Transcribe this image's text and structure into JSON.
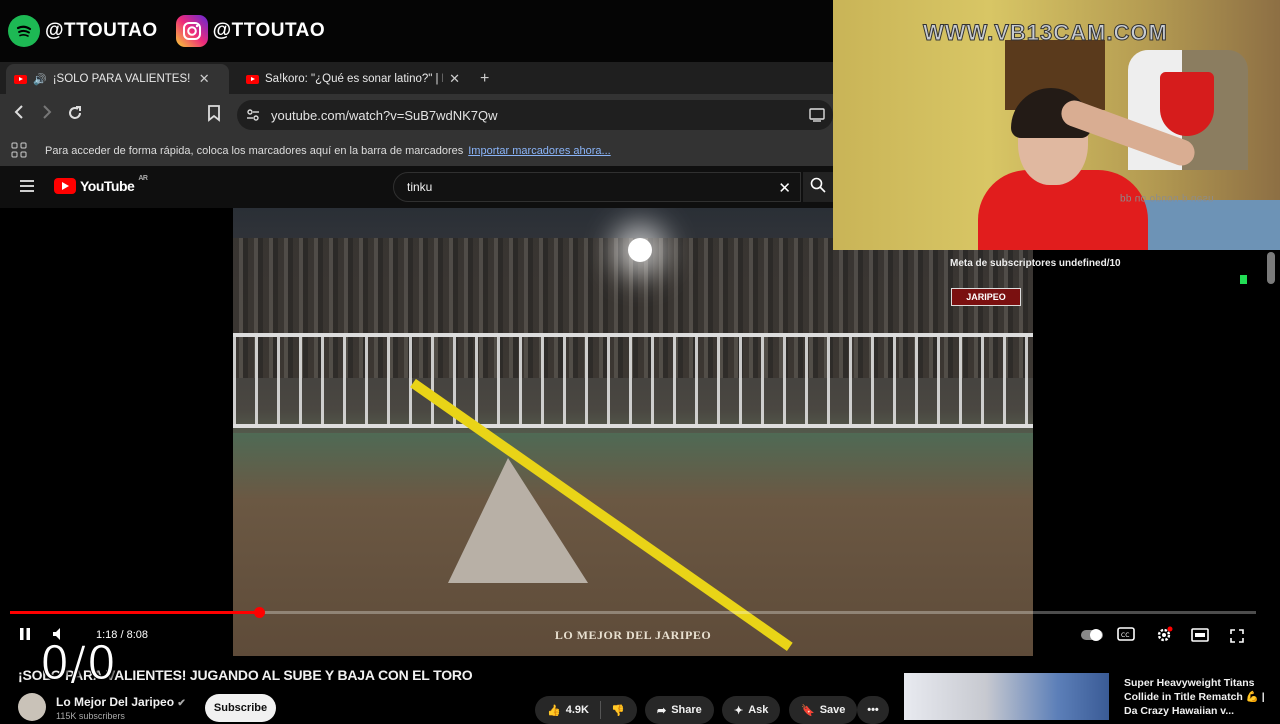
{
  "social": {
    "spotify_handle": "@TTOUTAO",
    "instagram_handle": "@TTOUTAO"
  },
  "browser": {
    "tabs": [
      {
        "label": "¡SOLO PARA VALIENTES! JUGA"
      },
      {
        "label": "Sa!koro: \"¿Qué es sonar latino?\" | Ent"
      }
    ],
    "url": "youtube.com/watch?v=SuB7wdNK7Qw",
    "bookmarks_hint": "Para acceder de forma rápida, coloca los marcadores aquí en la barra de marcadores",
    "bookmarks_link": "Importar marcadores ahora..."
  },
  "youtube": {
    "logo": "YouTube",
    "region": "AR",
    "search_query": "tinku"
  },
  "video": {
    "watermark": "LO MEJOR DEL JARIPEO",
    "corner_logo": "JARIPEO",
    "progress_fraction": 0.2,
    "time": "1:18 / 8:08"
  },
  "meta": {
    "title": "¡SOLO PARA VALIENTES! JUGANDO AL SUBE Y BAJA CON EL TORO",
    "channel": "Lo Mejor Del Jaripeo",
    "subscribers": "115K subscribers",
    "subscribe_label": "Subscribe",
    "likes": "4.9K",
    "share_label": "Share",
    "ask_label": "Ask",
    "save_label": "Save"
  },
  "overlay": {
    "counter": "0/0",
    "cam_site": "WWW.VB13CAM.COM",
    "cam_mirrored_text": "pp uo opuou p uesn",
    "subscriber_goal": "Meta de subscriptores undefined/10"
  },
  "sidebar": {
    "video_title": "Super Heavyweight Titans Collide in Title Rematch 💪 | Da Crazy Hawaiian v..."
  },
  "colors": {
    "youtube_red": "#ff0000",
    "spotify_green": "#1db954",
    "link_blue": "#8ab4f8"
  }
}
